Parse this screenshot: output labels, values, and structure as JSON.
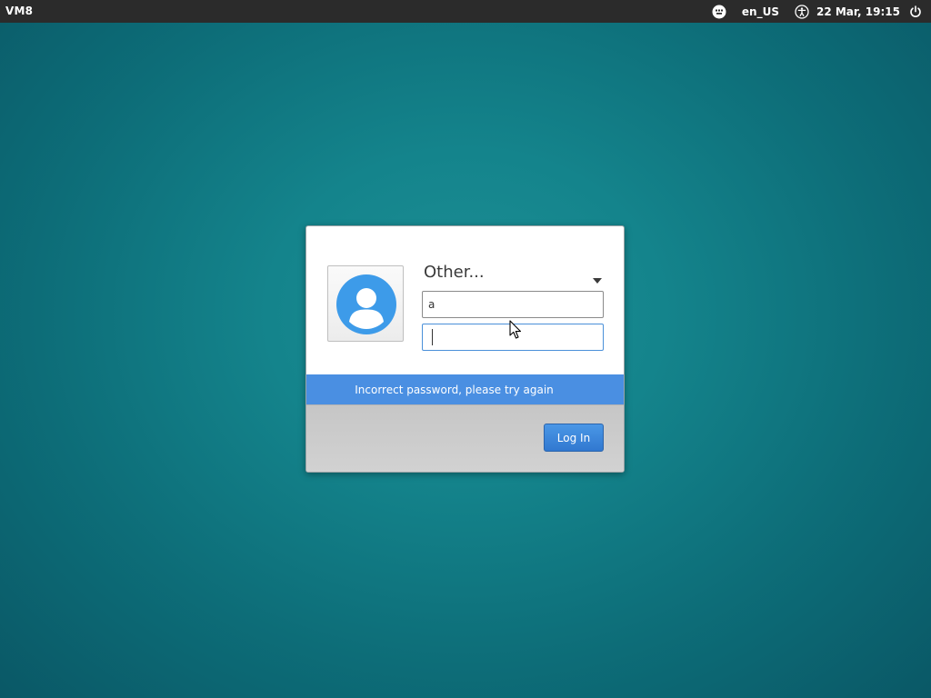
{
  "top_panel": {
    "hostname": "VM8",
    "keyboard_layout": "en_US",
    "datetime": "22 Mar, 19:15",
    "icons": [
      "keyboard-icon",
      "accessibility-icon",
      "power-icon"
    ]
  },
  "login": {
    "selected_user": "Other...",
    "username_value": "a",
    "password_value": "",
    "error_message": "Incorrect password, please try again",
    "login_button_label": "Log In"
  },
  "colors": {
    "panel_bg": "#2b2b2b",
    "desktop_bg": "#14848c",
    "accent": "#4a8fe2",
    "avatar": "#3d9be9"
  }
}
